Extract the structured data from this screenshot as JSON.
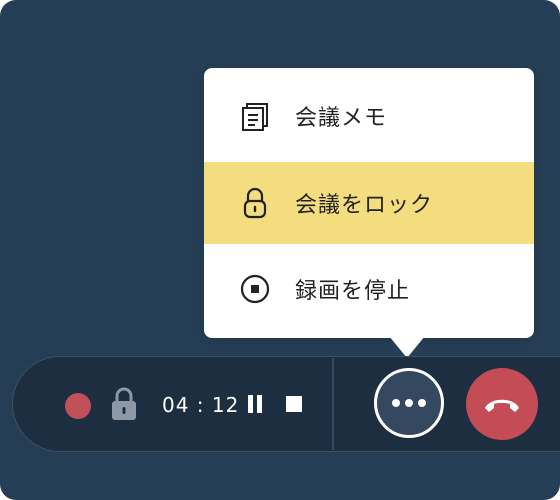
{
  "colors": {
    "background": "#263e55",
    "control_bar": "#1c2e40",
    "menu_highlight": "#f4dd7e",
    "record_red": "#c0505a",
    "hangup_red": "#c44c57"
  },
  "menu": {
    "items": [
      {
        "label": "会議メモ",
        "icon": "documents-icon"
      },
      {
        "label": "会議をロック",
        "icon": "lock-icon",
        "highlighted": true
      },
      {
        "label": "録画を停止",
        "icon": "stop-record-icon"
      }
    ]
  },
  "controls": {
    "timer": "04 : 12",
    "icons": {
      "record": "record-dot-icon",
      "lock": "lock-icon",
      "pause": "pause-icon",
      "stop": "stop-icon",
      "more": "more-icon",
      "hangup": "hang-up-icon"
    }
  }
}
